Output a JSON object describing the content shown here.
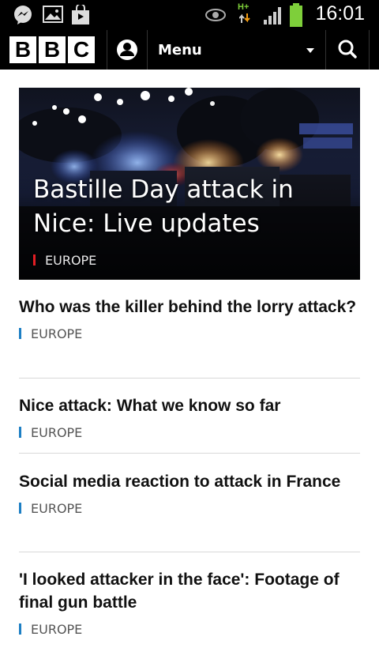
{
  "status_bar": {
    "time": "16:01",
    "network": "H+",
    "icons": [
      "messenger-icon",
      "image-icon",
      "shopping-bag-icon",
      "eye-icon",
      "signal-icon",
      "battery-icon"
    ]
  },
  "header": {
    "logo_letters": [
      "B",
      "B",
      "C"
    ],
    "menu_label": "Menu"
  },
  "hero": {
    "title": "Bastille Day attack in Nice: Live updates",
    "section": "EUROPE",
    "accent_color": "#e31e24"
  },
  "stories": [
    {
      "title": "Who was the killer behind the lorry attack?",
      "section": "EUROPE"
    },
    {
      "title": "Nice attack: What we know so far",
      "section": "EUROPE"
    },
    {
      "title": "Social media reaction to attack in France",
      "section": "EUROPE"
    },
    {
      "title": "'I looked attacker in the face': Footage of final gun battle",
      "section": "EUROPE"
    }
  ],
  "colors": {
    "section_marker": "#1d7fc4",
    "header_bg": "#000000"
  }
}
